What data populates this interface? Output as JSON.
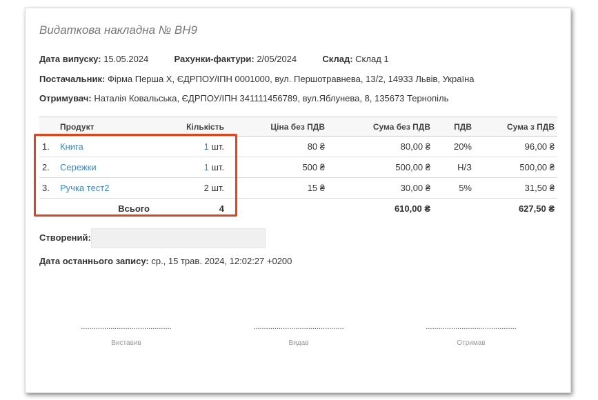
{
  "document": {
    "title": "Видаткова накладна № ВН9",
    "issue_date_label": "Дата випуску:",
    "issue_date": "15.05.2024",
    "invoice_label": "Рахунки-фактури:",
    "invoice": "2/05/2024",
    "warehouse_label": "Склад:",
    "warehouse": "Склад 1",
    "supplier_label": "Постачальник:",
    "supplier": "Фірма Перша Х, ЄДРПОУ/ІПН 0001000, вул. Першотравнева, 13/2, 14933 Львів, Україна",
    "recipient_label": "Отримувач:",
    "recipient": "Наталія Ковальська, ЄДРПОУ/ІПН 341111456789, вул.Яблунева, 8, 135673 Тернопіль"
  },
  "table": {
    "headers": {
      "product": "Продукт",
      "quantity": "Кількість",
      "price_no_vat": "Ціна без ПДВ",
      "sum_no_vat": "Сума без ПДВ",
      "vat": "ПДВ",
      "sum_with_vat": "Сума з ПДВ"
    },
    "rows": [
      {
        "num": "1.",
        "product": "Книга",
        "qty": "1",
        "unit": "шт.",
        "price": "80 ₴",
        "sum": "80,00 ₴",
        "vat": "20%",
        "total": "96,00 ₴"
      },
      {
        "num": "2.",
        "product": "Сережки",
        "qty": "1",
        "unit": "шт.",
        "price": "500 ₴",
        "sum": "500,00 ₴",
        "vat": "Н/З",
        "total": "500,00 ₴"
      },
      {
        "num": "3.",
        "product": "Ручка тест2",
        "qty": "2",
        "unit": "шт.",
        "price": "15 ₴",
        "sum": "30,00 ₴",
        "vat": "5%",
        "total": "31,50 ₴"
      }
    ],
    "total": {
      "label": "Всього",
      "qty": "4",
      "sum": "610,00 ₴",
      "total": "627,50 ₴"
    }
  },
  "footer": {
    "created_label": "Створений:",
    "last_record_label": "Дата останнього запису:",
    "last_record": "ср., 15 трав. 2024, 12:02:27 +0200",
    "signature_dots": "...........................................",
    "signatures": [
      "Виставив",
      "Видав",
      "Отримав"
    ]
  },
  "colors": {
    "link": "#3a87c8",
    "highlight": "#e5441b"
  }
}
